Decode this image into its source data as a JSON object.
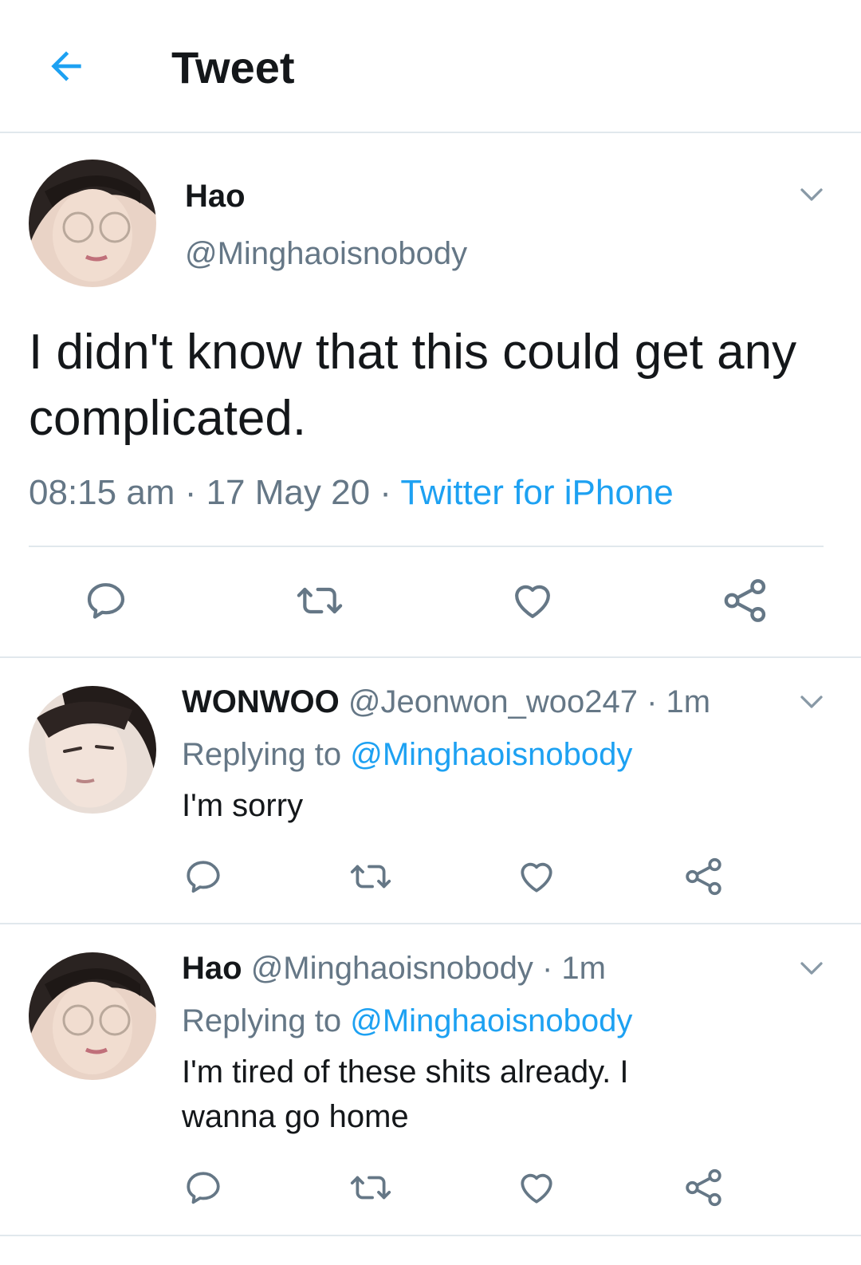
{
  "header": {
    "title": "Tweet",
    "back_icon": "arrow-left-icon",
    "accent": "#1da1f2"
  },
  "main_tweet": {
    "name": "Hao",
    "handle": "@Minghaoisnobody",
    "text": "I didn't know that this could get any complicated.",
    "time": "08:15 am",
    "sep1": " · ",
    "date": "17 May 20",
    "sep2": " · ",
    "source": "Twitter for iPhone"
  },
  "replies": [
    {
      "name": "WONWOO",
      "handle": "@Jeonwon_woo247",
      "sep": " · ",
      "time": "1m",
      "replying_label": "Replying to ",
      "replying_to": "@Minghaoisnobody",
      "text": "I'm sorry"
    },
    {
      "name": "Hao",
      "handle": "@Minghaoisnobody",
      "sep": " · ",
      "time": "1m",
      "replying_label": "Replying to ",
      "replying_to": "@Minghaoisnobody",
      "text": "I'm tired of these shits already. I wanna go home"
    }
  ],
  "colors": {
    "text": "#14171a",
    "secondary": "#657786",
    "link": "#1da1f2",
    "divider": "#e1e8ed"
  }
}
